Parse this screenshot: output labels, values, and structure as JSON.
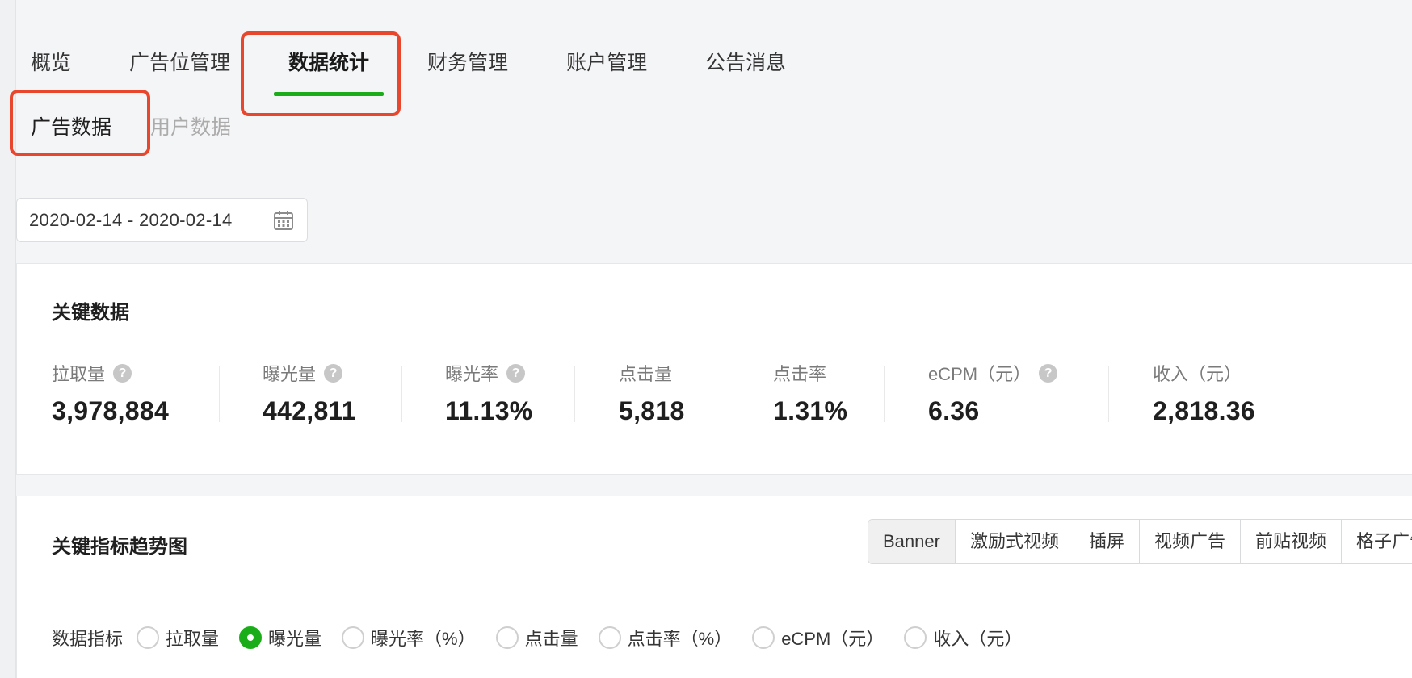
{
  "tabs": [
    {
      "label": "概览"
    },
    {
      "label": "广告位管理"
    },
    {
      "label": "数据统计",
      "active": true
    },
    {
      "label": "财务管理"
    },
    {
      "label": "账户管理"
    },
    {
      "label": "公告消息"
    }
  ],
  "subtabs": [
    {
      "label": "广告数据",
      "active": true
    },
    {
      "label": "用户数据"
    }
  ],
  "date_range": "2020-02-14 - 2020-02-14",
  "key_data": {
    "title": "关键数据",
    "metrics": [
      {
        "label": "拉取量",
        "value": "3,978,884",
        "help": "?"
      },
      {
        "label": "曝光量",
        "value": "442,811",
        "help": "?"
      },
      {
        "label": "曝光率",
        "value": "11.13%",
        "help": "?"
      },
      {
        "label": "点击量",
        "value": "5,818"
      },
      {
        "label": "点击率",
        "value": "1.31%"
      },
      {
        "label": "eCPM（元）",
        "value": "6.36",
        "help": "?"
      },
      {
        "label": "收入（元）",
        "value": "2,818.36"
      }
    ]
  },
  "trend": {
    "title": "关键指标趋势图",
    "ad_types": [
      "Banner",
      "激励式视频",
      "插屏",
      "视频广告",
      "前贴视频",
      "格子广告"
    ],
    "selected_ad_type": "Banner",
    "indicator_label": "数据指标",
    "indicators": [
      "拉取量",
      "曝光量",
      "曝光率（%）",
      "点击量",
      "点击率（%）",
      "eCPM（元）",
      "收入（元）"
    ],
    "selected_indicator": "曝光量"
  },
  "colors": {
    "accent": "#1aad19",
    "annotation": "#e8472d"
  }
}
